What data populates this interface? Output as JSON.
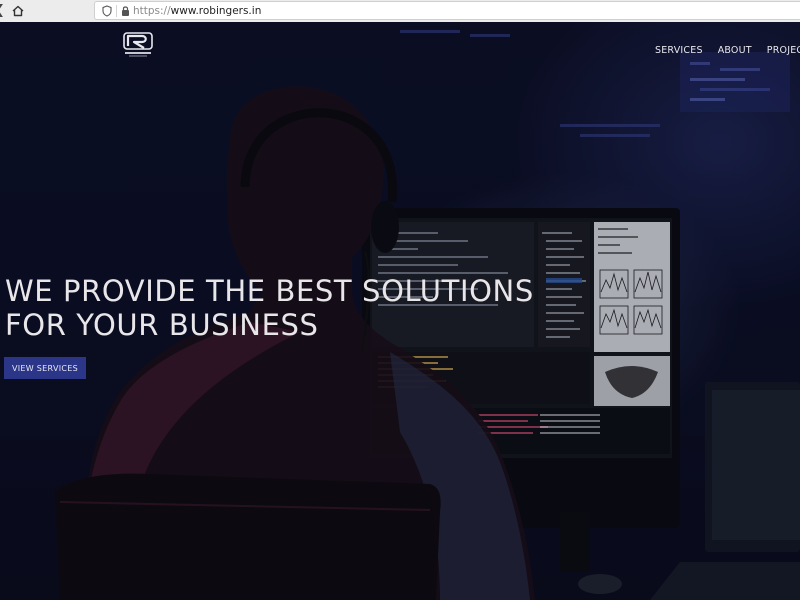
{
  "browser": {
    "url_protocol": "https://",
    "url_host": "www.robingers.in",
    "icons": [
      "back-arrow-icon",
      "home-icon",
      "shield-icon",
      "lock-icon"
    ]
  },
  "site": {
    "logo": {
      "icon": "robingers-logo-icon"
    },
    "nav": [
      {
        "label": "SERVICES"
      },
      {
        "label": "ABOUT"
      },
      {
        "label": "PROJECTS"
      }
    ],
    "hero": {
      "headline_line1": "WE PROVIDE THE BEST SOLUTIONS",
      "headline_line2": "FOR YOUR BUSINESS",
      "cta_label": "VIEW SERVICES",
      "cta_color": "#2c3689"
    }
  }
}
